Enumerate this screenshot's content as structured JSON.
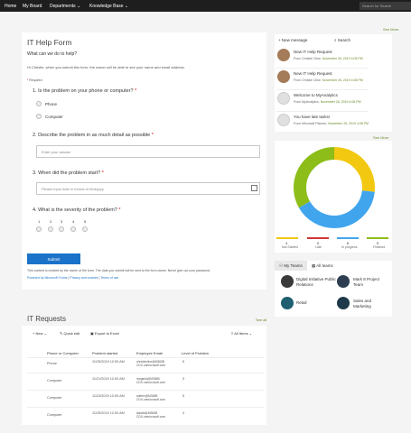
{
  "topnav": {
    "items": [
      "Home",
      "My Board",
      "Departments",
      "Knowledge Base"
    ],
    "search_placeholder": "Search for Search"
  },
  "form": {
    "title": "IT Help Form",
    "subtitle": "What can we do to help?",
    "notice": "Hi Christie, when you submit this form, the owner will be able to see your name and email address.",
    "required_label": "Required",
    "q1": "1. Is the problem on your phone or computer?",
    "q1_options": [
      "Phone",
      "Computer"
    ],
    "q2": "2. Describe the problem in as much detail as possible",
    "q2_placeholder": "Enter your answer",
    "q3": "3. When did the problem start?",
    "q3_placeholder": "Please input date in format of M/d/yyyy",
    "q4": "4. What is the severity of the problem?",
    "q4_scale": [
      "1",
      "2",
      "3",
      "4",
      "5"
    ],
    "submit_label": "Submit",
    "footer": "This content is created by the owner of the form. The data you submit will be sent to the form owner. Never give out your password.",
    "powered": "Powered by Microsoft Forms",
    "privacy": "Privacy and cookies",
    "terms": "Terms of use"
  },
  "right": {
    "see_more_1": "See More",
    "new_message": "New message",
    "search": "Search",
    "messages": [
      {
        "title": "New IT Help Request",
        "from": "From Christie Cline,",
        "date": "November 26, 2019 4:08 PM"
      },
      {
        "title": "New IT Help Request",
        "from": "From Christie Cline,",
        "date": "November 26, 2019 4:08 PM"
      },
      {
        "title": "Welcome to MyAnalytics",
        "from": "From MyAnalytics,",
        "date": "November 26, 2019 4:08 PM"
      },
      {
        "title": "You have late tasks!",
        "from": "From Microsoft Planner,",
        "date": "November 26, 2019 4:08 PM"
      }
    ],
    "see_more_2": "See More",
    "legend": [
      {
        "num": "4",
        "label": "Not Started",
        "color": "#f2c811"
      },
      {
        "num": "0",
        "label": "Late",
        "color": "#d13438"
      },
      {
        "num": "6",
        "label": "In progress",
        "color": "#41a5ee"
      },
      {
        "num": "5",
        "label": "Finished",
        "color": "#8cbd18"
      }
    ],
    "teams_tab_1": "My Teams",
    "teams_tab_2": "All teams",
    "teams": [
      {
        "name": "Digital Initiative Public Relations"
      },
      {
        "name": "Mark 8 Project Team"
      },
      {
        "name": "Retail"
      },
      {
        "name": "Sales and Marketing"
      }
    ]
  },
  "requests": {
    "title": "IT Requests",
    "see_all": "See all",
    "toolbar": {
      "new": "New",
      "quick_edit": "Quick edit",
      "export": "Export to Excel",
      "all_items": "All Items"
    },
    "columns": [
      "Phone or Computer",
      "Problem started",
      "Employee Email",
      "Level of Problem"
    ],
    "rows": [
      {
        "device": "Phone",
        "date": "11/25/2019 12:00 AM",
        "email": "christiecline@M365B CDX.onmicrosoft.com",
        "level": "5"
      },
      {
        "device": "Computer",
        "date": "11/21/2019 12:00 AM",
        "email": "meganb@M365B CDX.onmicrosoft.com",
        "level": "3"
      },
      {
        "device": "Computer",
        "date": "11/23/2019 12:00 AM",
        "email": "adelev@M365B CDX.onmicrosoft.com",
        "level": "5"
      },
      {
        "device": "Computer",
        "date": "11/25/2019 12:00 AM",
        "email": "isaiahl@M365B CDX.onmicrosoft.com",
        "level": "4"
      }
    ]
  },
  "colors": {
    "accent": "#1a73c8",
    "green": "#6a8a2a"
  }
}
